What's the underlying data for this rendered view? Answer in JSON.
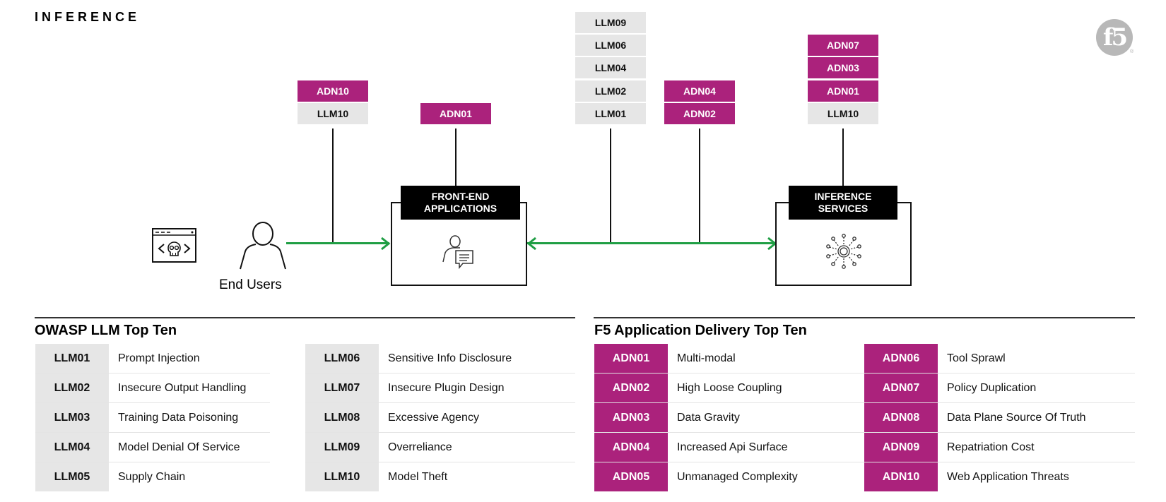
{
  "header": {
    "title": "INFERENCE",
    "logo": "f5",
    "logo_mark": "®"
  },
  "diagram": {
    "end_users_label": "End Users",
    "front_end": {
      "label_line1": "FRONT-END",
      "label_line2": "APPLICATIONS"
    },
    "inference": {
      "label_line1": "INFERENCE",
      "label_line2": "SERVICES"
    },
    "stacks": {
      "users_to_frontend": [
        "ADN10",
        "LLM10"
      ],
      "frontend_top": [
        "ADN01"
      ],
      "link_llm": [
        "LLM09",
        "LLM06",
        "LLM04",
        "LLM02",
        "LLM01"
      ],
      "link_adn": [
        "ADN04",
        "ADN02"
      ],
      "inference_top": [
        "ADN07",
        "ADN03",
        "ADN01",
        "LLM10"
      ]
    }
  },
  "owasp": {
    "title": "OWASP LLM Top Ten",
    "items": [
      {
        "code": "LLM01",
        "name": "Prompt Injection"
      },
      {
        "code": "LLM02",
        "name": "Insecure Output Handling"
      },
      {
        "code": "LLM03",
        "name": "Training Data Poisoning"
      },
      {
        "code": "LLM04",
        "name": "Model Denial Of Service"
      },
      {
        "code": "LLM05",
        "name": "Supply Chain"
      },
      {
        "code": "LLM06",
        "name": "Sensitive Info Disclosure"
      },
      {
        "code": "LLM07",
        "name": "Insecure Plugin Design"
      },
      {
        "code": "LLM08",
        "name": "Excessive Agency"
      },
      {
        "code": "LLM09",
        "name": "Overreliance"
      },
      {
        "code": "LLM10",
        "name": "Model Theft"
      }
    ]
  },
  "f5": {
    "title": "F5 Application Delivery Top Ten",
    "items": [
      {
        "code": "ADN01",
        "name": "Multi-modal"
      },
      {
        "code": "ADN02",
        "name": "High Loose Coupling"
      },
      {
        "code": "ADN03",
        "name": "Data Gravity"
      },
      {
        "code": "ADN04",
        "name": "Increased Api Surface"
      },
      {
        "code": "ADN05",
        "name": "Unmanaged Complexity"
      },
      {
        "code": "ADN06",
        "name": "Tool Sprawl"
      },
      {
        "code": "ADN07",
        "name": "Policy Duplication"
      },
      {
        "code": "ADN08",
        "name": "Data Plane Source Of Truth"
      },
      {
        "code": "ADN09",
        "name": "Repatriation Cost"
      },
      {
        "code": "ADN10",
        "name": "Web Application Threats"
      }
    ]
  },
  "colors": {
    "adn": "#ab227c",
    "llm": "#e6e6e6",
    "flow": "#1f9e44"
  }
}
